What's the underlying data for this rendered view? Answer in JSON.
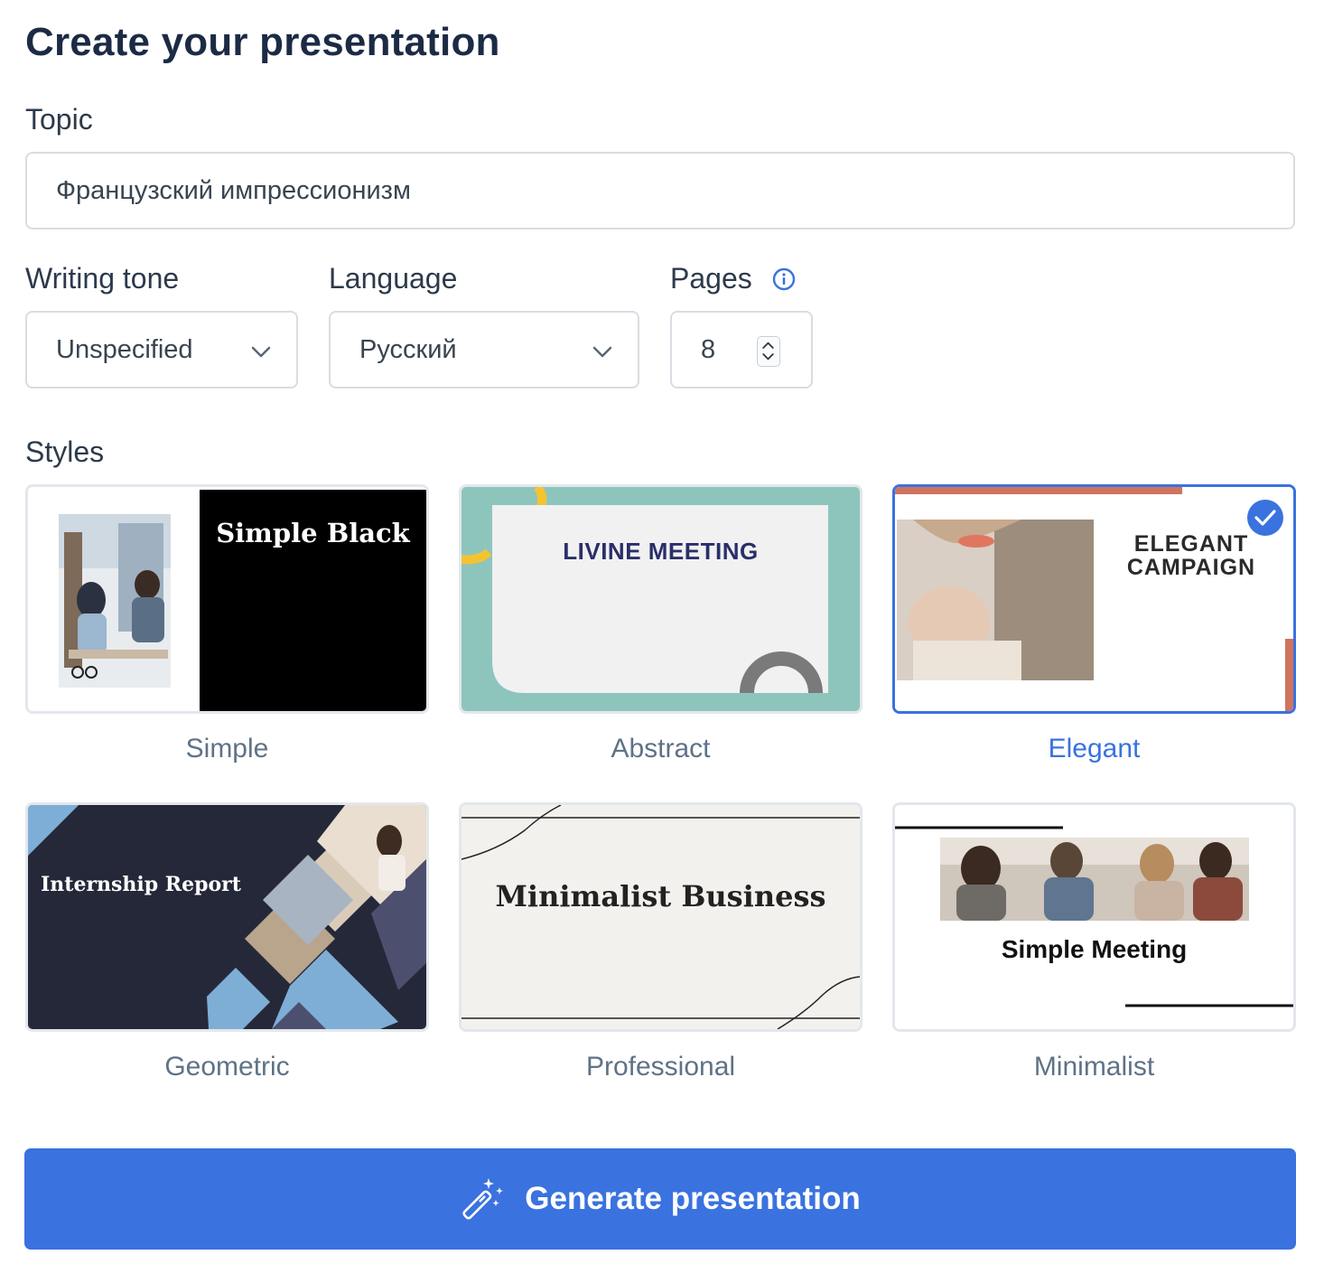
{
  "header": {
    "title": "Create your presentation"
  },
  "topic": {
    "label": "Topic",
    "value": "Французский импрессионизм"
  },
  "writing_tone": {
    "label": "Writing tone",
    "value": "Unspecified"
  },
  "language": {
    "label": "Language",
    "value": "Русский"
  },
  "pages": {
    "label": "Pages",
    "value": "8"
  },
  "styles": {
    "label": "Styles",
    "items": [
      {
        "label": "Simple",
        "preview_title": "Simple Black",
        "selected": false
      },
      {
        "label": "Abstract",
        "preview_title": "LIVINE MEETING",
        "selected": false
      },
      {
        "label": "Elegant",
        "preview_title_line1": "ELEGANT",
        "preview_title_line2": "CAMPAIGN",
        "selected": true
      },
      {
        "label": "Geometric",
        "preview_title": "Internship Report",
        "selected": false
      },
      {
        "label": "Professional",
        "preview_title": "Minimalist Business",
        "selected": false
      },
      {
        "label": "Minimalist",
        "preview_title": "Simple Meeting",
        "selected": false
      }
    ]
  },
  "generate_button": {
    "label": "Generate presentation"
  },
  "colors": {
    "accent": "#3a72df",
    "title": "#1c2b45"
  }
}
